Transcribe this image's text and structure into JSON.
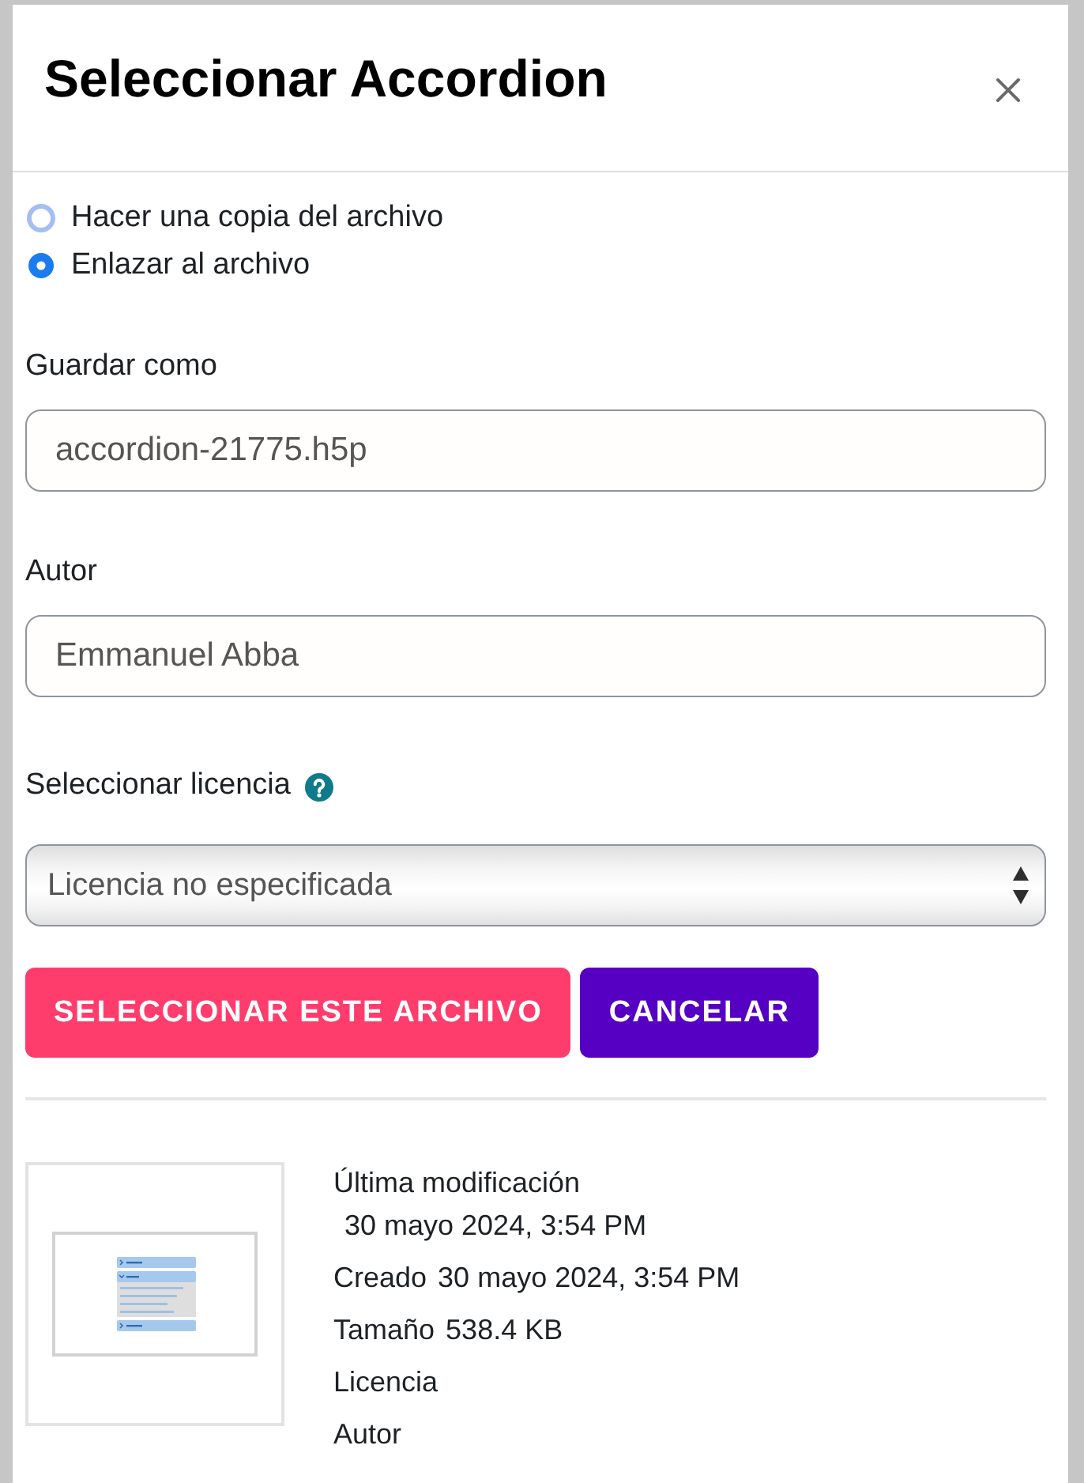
{
  "dialog": {
    "title": "Seleccionar Accordion"
  },
  "link_options": [
    {
      "label": "Hacer una copia del archivo",
      "selected": false,
      "focused": true
    },
    {
      "label": "Enlazar al archivo",
      "selected": true,
      "focused": false
    }
  ],
  "fields": [
    {
      "label": "Guardar como",
      "value": "accordion-21775.h5p"
    },
    {
      "label": "Autor",
      "value": "Emmanuel Abba"
    }
  ],
  "license": {
    "label": "Seleccionar licencia",
    "value": "Licencia no especificada"
  },
  "buttons": [
    {
      "label": "SELECCIONAR ESTE ARCHIVO",
      "kind": "primary"
    },
    {
      "label": "CANCELAR",
      "kind": "secondary"
    }
  ],
  "file_info": [
    {
      "label": "Última modificación",
      "value": "30 mayo 2024, 3:54 PM"
    },
    {
      "label": "Creado",
      "value": "30 mayo 2024, 3:54 PM"
    },
    {
      "label": "Tamaño",
      "value": "538.4 KB"
    },
    {
      "label": "Licencia"
    },
    {
      "label": "Autor"
    }
  ]
}
